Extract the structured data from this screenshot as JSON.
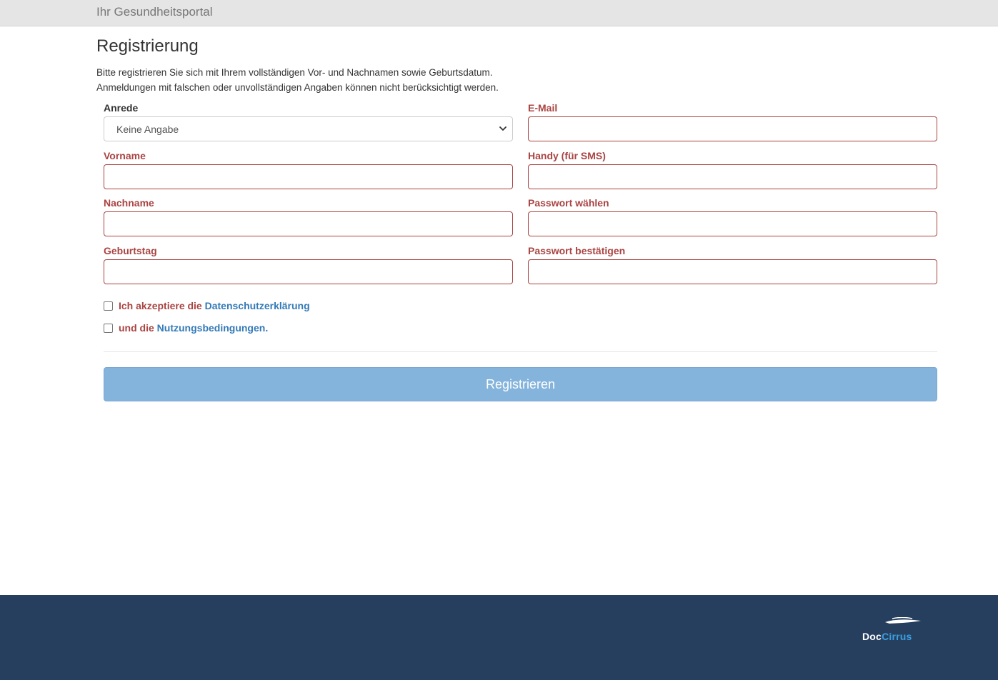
{
  "header": {
    "brand": "Ihr Gesundheitsportal"
  },
  "page": {
    "title": "Registrierung",
    "intro_line1": "Bitte registrieren Sie sich mit Ihrem vollständigen Vor- und Nachnamen sowie Geburtsdatum.",
    "intro_line2": "Anmeldungen mit falschen oder unvollständigen Angaben können nicht berücksichtigt werden."
  },
  "form": {
    "anrede": {
      "label": "Anrede",
      "selected": "Keine Angabe"
    },
    "vorname": {
      "label": "Vorname",
      "value": ""
    },
    "nachname": {
      "label": "Nachname",
      "value": ""
    },
    "geburtstag": {
      "label": "Geburtstag",
      "value": ""
    },
    "email": {
      "label": "E-Mail",
      "value": ""
    },
    "handy": {
      "label": "Handy (für SMS)",
      "value": ""
    },
    "passwort": {
      "label": "Passwort wählen",
      "value": ""
    },
    "passwort_confirm": {
      "label": "Passwort bestätigen",
      "value": ""
    },
    "privacy": {
      "prefix": "Ich akzeptiere die ",
      "link": "Datenschutzerklärung",
      "checked": false
    },
    "terms": {
      "prefix": "und die ",
      "link": "Nutzungsbedingungen",
      "suffix": ".",
      "checked": false
    },
    "submit_label": "Registrieren"
  },
  "footer": {
    "logo_doc": "Doc",
    "logo_cirrus": "Cirrus"
  },
  "colors": {
    "error": "#a94442",
    "link": "#337ab7",
    "button": "#84b3dc",
    "footer": "#273f5f",
    "topbar": "#e5e5e5"
  },
  "icons": {
    "select": "chevron-down-icon",
    "logo": "cloud-swoosh-icon"
  }
}
